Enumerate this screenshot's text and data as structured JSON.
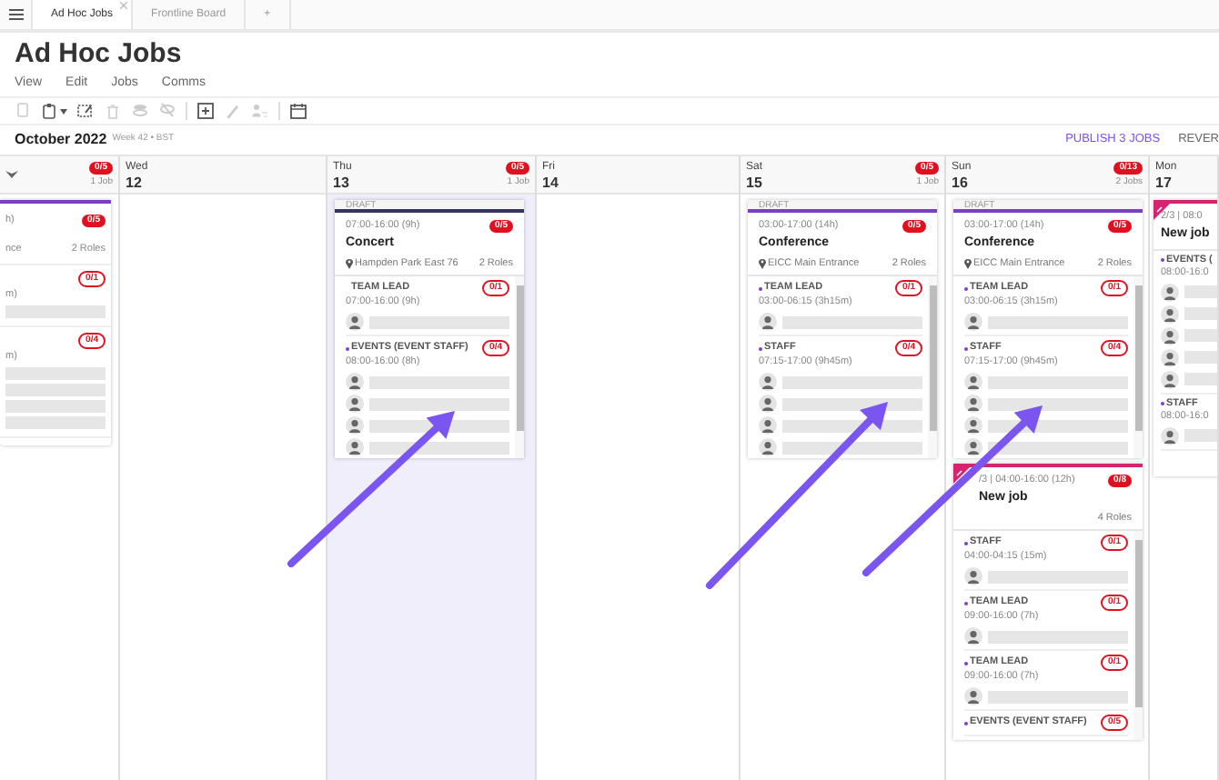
{
  "tabs": [
    {
      "label": "Ad Hoc Jobs",
      "selected": true
    },
    {
      "label": "Frontline Board",
      "selected": false
    },
    {
      "label": "+",
      "selected": false
    }
  ],
  "title": "Ad Hoc Jobs",
  "menu": [
    "View",
    "Edit",
    "Jobs",
    "Comms"
  ],
  "toolbar": [
    {
      "disabled": true
    },
    {
      "disabled": false
    },
    {
      "disabled": false
    },
    {
      "disabled": true
    },
    {
      "disabled": true
    },
    {
      "disabled": true
    },
    {
      "disabled": false
    },
    {
      "disabled": true
    },
    {
      "disabled": true
    },
    {
      "disabled": false
    }
  ],
  "period": {
    "month": "October 2022",
    "week": "Week 42 • BST"
  },
  "actions": [
    {
      "label": "PUBLISH 3 JOBS",
      "kind": "primary"
    },
    {
      "label": "REVER",
      "kind": "secondary"
    }
  ],
  "columns": [
    {
      "kind": "cut",
      "badge": "0/5",
      "jobs": "1 Job",
      "highlighted": false,
      "cards": [
        {
          "kind": "cut",
          "color": "#7b3fc4",
          "time": "h)",
          "badge": "0/5",
          "location": "nce",
          "roles_count": "2 Roles",
          "roles": [
            {
              "time": "m)",
              "badge": "0/1",
              "slots": [
                {
                  "assigned": false
                }
              ]
            },
            {
              "time": "m)",
              "badge": "0/4",
              "slots": [
                {
                  "assigned": false
                },
                {
                  "assigned": false
                },
                {
                  "assigned": false
                },
                {
                  "assigned": false
                }
              ]
            }
          ]
        }
      ]
    },
    {
      "kind": "day",
      "day": "Wed",
      "date": "12",
      "highlighted": false
    },
    {
      "kind": "day",
      "day": "Thu",
      "date": "13",
      "badge": "0/5",
      "jobs": "1 Job",
      "highlighted": true,
      "cards": [
        {
          "kind": "job",
          "status": "DRAFT",
          "color": "#34345e",
          "time": "07:00-16:00 (9h)",
          "badge": "0/5",
          "title": "Concert",
          "location": "Hampden Park East 76",
          "roles_count": "2 Roles",
          "roles": [
            {
              "name": "TEAM LEAD",
              "marked": false,
              "time": "07:00-16:00 (9h)",
              "badge": "0/1",
              "slots": [
                {
                  "assigned": false
                }
              ]
            },
            {
              "name": "EVENTS (EVENT STAFF)",
              "marked": true,
              "time": "08:00-16:00 (8h)",
              "badge": "0/4",
              "slots": [
                {
                  "assigned": false
                },
                {
                  "assigned": false
                },
                {
                  "assigned": false
                },
                {
                  "assigned": false
                }
              ]
            }
          ]
        }
      ]
    },
    {
      "kind": "day",
      "day": "Fri",
      "date": "14",
      "highlighted": false
    },
    {
      "kind": "day",
      "day": "Sat",
      "date": "15",
      "badge": "0/5",
      "jobs": "1 Job",
      "highlighted": false,
      "cards": [
        {
          "kind": "job",
          "status": "DRAFT",
          "color": "#7b3fc4",
          "time": "03:00-17:00 (14h)",
          "badge": "0/5",
          "title": "Conference",
          "location": "EICC Main Entrance",
          "roles_count": "2 Roles",
          "roles": [
            {
              "name": "TEAM LEAD",
              "marked": true,
              "time": "03:00-06:15 (3h15m)",
              "badge": "0/1",
              "slots": [
                {
                  "assigned": false
                }
              ]
            },
            {
              "name": "STAFF",
              "marked": true,
              "time": "07:15-17:00 (9h45m)",
              "badge": "0/4",
              "slots": [
                {
                  "assigned": false
                },
                {
                  "assigned": false
                },
                {
                  "assigned": false
                },
                {
                  "assigned": false
                }
              ]
            }
          ]
        }
      ]
    },
    {
      "kind": "day",
      "day": "Sun",
      "date": "16",
      "badge": "0/13",
      "jobs": "2 Jobs",
      "highlighted": false,
      "cards": [
        {
          "kind": "job",
          "status": "DRAFT",
          "color": "#7b3fc4",
          "time": "03:00-17:00 (14h)",
          "badge": "0/5",
          "title": "Conference",
          "location": "EICC Main Entrance",
          "roles_count": "2 Roles",
          "roles": [
            {
              "name": "TEAM LEAD",
              "marked": true,
              "time": "03:00-06:15 (3h15m)",
              "badge": "0/1",
              "slots": [
                {
                  "assigned": false
                }
              ]
            },
            {
              "name": "STAFF",
              "marked": true,
              "time": "07:15-17:00 (9h45m)",
              "badge": "0/4",
              "slots": [
                {
                  "assigned": false
                },
                {
                  "assigned": false
                },
                {
                  "assigned": false
                },
                {
                  "assigned": false
                }
              ]
            }
          ]
        },
        {
          "kind": "new",
          "color": "#d6246e",
          "time": "/3 | 04:00-16:00 (12h)",
          "badge": "0/8",
          "title": "New job",
          "roles_count": "4 Roles",
          "roles": [
            {
              "name": "STAFF",
              "marked": true,
              "time": "04:00-04:15 (15m)",
              "badge": "0/1",
              "slots": [
                {
                  "assigned": false
                }
              ]
            },
            {
              "name": "TEAM LEAD",
              "marked": true,
              "time": "09:00-16:00 (7h)",
              "badge": "0/1",
              "slots": [
                {
                  "assigned": false
                }
              ]
            },
            {
              "name": "TEAM LEAD",
              "marked": true,
              "time": "09:00-16:00 (7h)",
              "badge": "0/1",
              "slots": [
                {
                  "assigned": false
                }
              ]
            },
            {
              "name": "EVENTS (EVENT STAFF)",
              "marked": true,
              "badge": "0/5"
            }
          ]
        }
      ]
    },
    {
      "kind": "day",
      "day": "Mon",
      "date": "17",
      "highlighted": false,
      "cards": [
        {
          "kind": "new",
          "color": "#d6246e",
          "time": "2/3 | 08:0",
          "title": "New job",
          "roles": [
            {
              "name": "EVENTS (",
              "marked": true,
              "time": "08:00-16:0",
              "slots": [
                {
                  "assigned": false
                },
                {
                  "assigned": false
                },
                {
                  "assigned": false
                },
                {
                  "assigned": false
                },
                {
                  "assigned": false
                }
              ]
            },
            {
              "name": "STAFF",
              "marked": true,
              "time": "08:00-16:0",
              "slots": [
                {
                  "assigned": false
                }
              ]
            }
          ]
        }
      ]
    }
  ]
}
